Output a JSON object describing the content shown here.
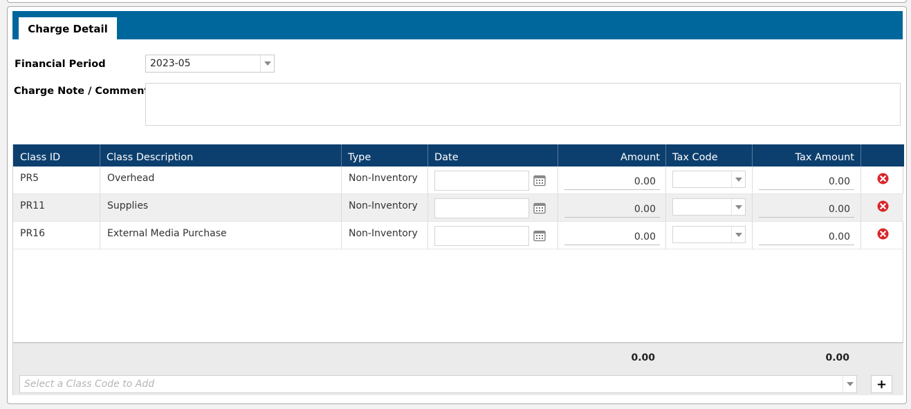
{
  "tab": {
    "label": "Charge Detail"
  },
  "form": {
    "financial_period_label": "Financial Period",
    "financial_period_value": "2023-05",
    "comment_label": "Charge Note / Comment",
    "comment_value": ""
  },
  "grid": {
    "columns": [
      "Class ID",
      "Class Description",
      "Type",
      "Date",
      "Amount",
      "Tax Code",
      "Tax Amount"
    ],
    "rows": [
      {
        "class_id": "PR5",
        "description": "Overhead",
        "type": "Non-Inventory",
        "date": "",
        "amount": "0.00",
        "tax_code": "",
        "tax_amount": "0.00"
      },
      {
        "class_id": "PR11",
        "description": "Supplies",
        "type": "Non-Inventory",
        "date": "",
        "amount": "0.00",
        "tax_code": "",
        "tax_amount": "0.00"
      },
      {
        "class_id": "PR16",
        "description": "External Media Purchase",
        "type": "Non-Inventory",
        "date": "",
        "amount": "0.00",
        "tax_code": "",
        "tax_amount": "0.00"
      }
    ],
    "totals": {
      "amount": "0.00",
      "tax_amount": "0.00"
    }
  },
  "add": {
    "placeholder": "Select a Class Code to Add",
    "button_label": "+"
  },
  "icons": {
    "calendar": "calendar-icon",
    "delete": "delete-icon",
    "dropdown": "chevron-down-icon"
  },
  "colors": {
    "tab_bar": "#00679c",
    "grid_header": "#0c3f6e",
    "delete_red": "#d9262a"
  }
}
